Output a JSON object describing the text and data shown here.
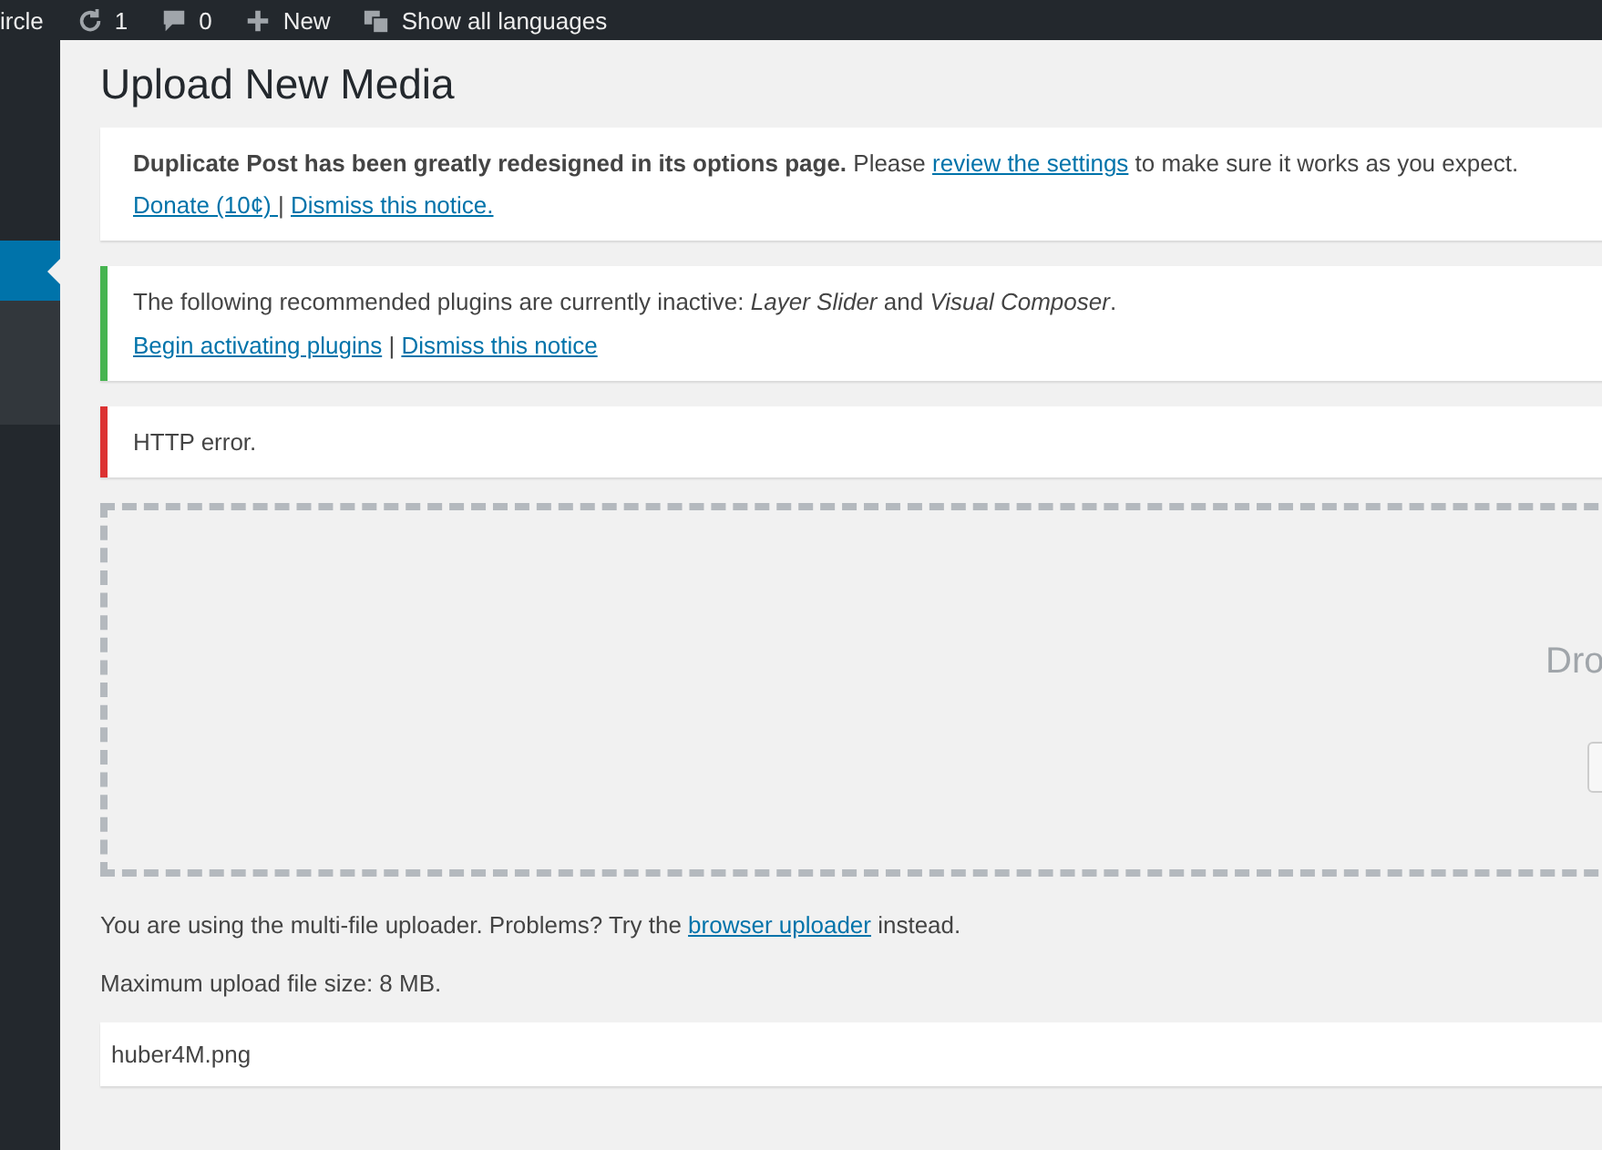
{
  "admin_bar": {
    "items": [
      {
        "kind": "text",
        "label": "ircle"
      },
      {
        "kind": "updates",
        "label": "1"
      },
      {
        "kind": "comments",
        "label": "0"
      },
      {
        "kind": "new",
        "label": "New"
      },
      {
        "kind": "languages",
        "label": "Show all languages"
      }
    ]
  },
  "sidebar": {
    "items": [
      {
        "kind": "menu",
        "selected": true
      },
      {
        "kind": "submenu",
        "selected": false
      }
    ]
  },
  "page_title": "Upload New Media",
  "notices": [
    {
      "color": "#ffffff",
      "lines": [
        [
          {
            "kind": "text",
            "text": "**Duplicate Post has been greatly redesigned in its options page.** Please "
          },
          {
            "kind": "link",
            "text": "review the settings"
          },
          {
            "kind": "text",
            "text": " to make sure it works as you expect."
          }
        ],
        [
          {
            "kind": "link",
            "text": "Donate (10¢) "
          },
          {
            "kind": "text",
            "text": " | "
          },
          {
            "kind": "link",
            "text": "Dismiss this notice."
          }
        ]
      ]
    },
    {
      "color": "#46b450",
      "lines": [
        [
          {
            "kind": "text",
            "text": "The following recommended plugins are currently inactive: *Layer Slider* and *Visual Composer*."
          }
        ],
        [
          {
            "kind": "link",
            "text": "Begin activating plugins"
          },
          {
            "kind": "text",
            "text": " | "
          },
          {
            "kind": "link",
            "text": "Dismiss this notice"
          }
        ]
      ]
    },
    {
      "color": "#dc3232",
      "lines": [
        [
          {
            "kind": "text",
            "text": "HTTP error."
          }
        ]
      ]
    }
  ],
  "drop_zone": {
    "title": "Dro"
  },
  "uploader_info": [
    {
      "kind": "text",
      "text": "You are using the multi-file uploader. Problems? Try the "
    },
    {
      "kind": "link",
      "text": "browser uploader"
    },
    {
      "kind": "text",
      "text": " instead."
    }
  ],
  "max_size": "Maximum upload file size: 8 MB.",
  "files": [
    {
      "name": "huber4M.png"
    }
  ]
}
